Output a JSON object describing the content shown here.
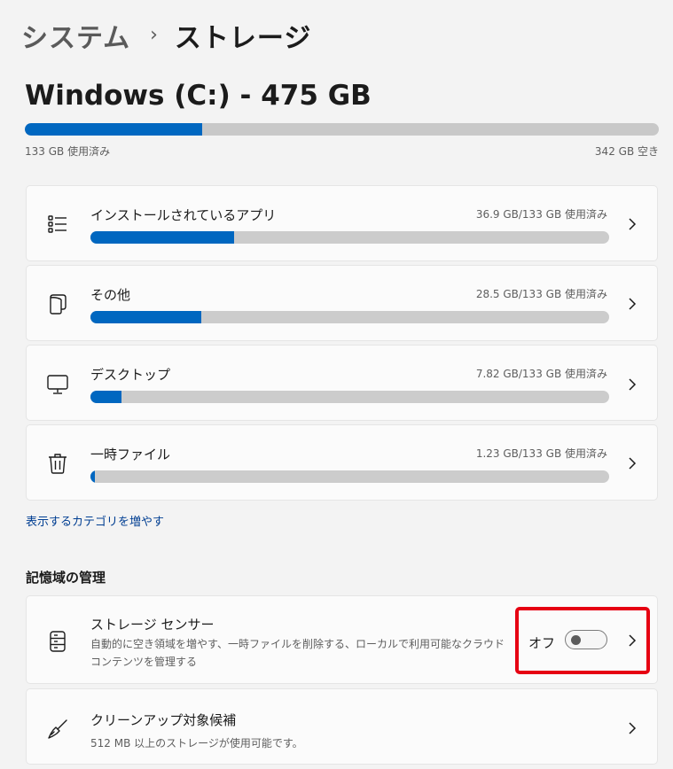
{
  "breadcrumb": {
    "parent": "システム",
    "separator": "›",
    "current": "ストレージ"
  },
  "drive": {
    "title": "Windows (C:) - 475 GB",
    "used_label": "133 GB 使用済み",
    "free_label": "342 GB 空き",
    "used_fraction": 0.28
  },
  "categories": [
    {
      "name": "インストールされているアプリ",
      "usage": "36.9 GB/133 GB 使用済み",
      "fraction": 0.277,
      "icon": "app-list-icon"
    },
    {
      "name": "その他",
      "usage": "28.5 GB/133 GB 使用済み",
      "fraction": 0.214,
      "icon": "document-icon"
    },
    {
      "name": "デスクトップ",
      "usage": "7.82 GB/133 GB 使用済み",
      "fraction": 0.059,
      "icon": "monitor-icon"
    },
    {
      "name": "一時ファイル",
      "usage": "1.23 GB/133 GB 使用済み",
      "fraction": 0.009,
      "icon": "trash-icon"
    }
  ],
  "more_categories_link": "表示するカテゴリを増やす",
  "storage_management": {
    "heading": "記憶域の管理",
    "storage_sense": {
      "title": "ストレージ センサー",
      "description": "自動的に空き領域を増やす、一時ファイルを削除する、ローカルで利用可能なクラウド コンテンツを管理する",
      "toggle_label": "オフ",
      "toggle_on": false,
      "icon": "drive-stack-icon"
    },
    "cleanup": {
      "title": "クリーンアップ対象候補",
      "description": "512 MB 以上のストレージが使用可能です。",
      "icon": "broom-icon"
    }
  },
  "colors": {
    "accent": "#0067c0",
    "bar_track": "#cccccc",
    "highlight": "#e60012",
    "link": "#003e92"
  }
}
